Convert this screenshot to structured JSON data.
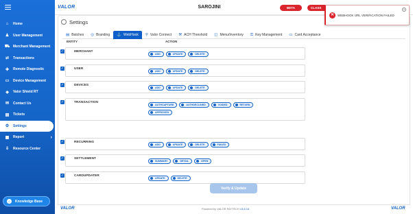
{
  "sidebar": {
    "items": [
      {
        "label": "Home",
        "icon": "home-icon"
      },
      {
        "label": "User Management",
        "icon": "user-icon"
      },
      {
        "label": "Merchant Management",
        "icon": "merchant-icon"
      },
      {
        "label": "Transactions",
        "icon": "transactions-icon"
      },
      {
        "label": "Remote Diagnostic",
        "icon": "diagnostic-icon"
      },
      {
        "label": "Device Management",
        "icon": "device-icon"
      },
      {
        "label": "Valor Shield RT",
        "icon": "shield-icon"
      },
      {
        "label": "Contact Us",
        "icon": "contact-icon"
      },
      {
        "label": "Tickets",
        "icon": "ticket-icon"
      },
      {
        "label": "Settings",
        "icon": "gear-icon"
      },
      {
        "label": "Report",
        "icon": "report-icon"
      },
      {
        "label": "Resource Center",
        "icon": "download-icon"
      }
    ],
    "active_index": 9,
    "knowledge_base": "Knowledge Base"
  },
  "header": {
    "logo": "VALOR",
    "store_name": "SAROJINI",
    "beta_label": "BETA",
    "classic_label": "CLASS"
  },
  "page": {
    "title": "Settings",
    "tabs": [
      {
        "label": "Batches",
        "icon": "batches-icon"
      },
      {
        "label": "Branding",
        "icon": "branding-icon"
      },
      {
        "label": "WebHook",
        "icon": "webhook-icon"
      },
      {
        "label": "Valor Connect",
        "icon": "link-icon"
      },
      {
        "label": "ACH Threshold",
        "icon": "threshold-icon"
      },
      {
        "label": "Menu/Inventory",
        "icon": "inventory-icon"
      },
      {
        "label": "Key Management",
        "icon": "key-icon"
      },
      {
        "label": "Card Acceptance",
        "icon": "card-icon"
      }
    ],
    "active_tab": 2,
    "columns": {
      "entity": "ENTITY",
      "action": "ACTION"
    },
    "rows": [
      {
        "entity": "MERCHANT",
        "checked": true,
        "actions": [
          "ADD",
          "UPDATE",
          "DELETE"
        ]
      },
      {
        "entity": "USER",
        "checked": true,
        "actions": [
          "ADD",
          "UPDATE",
          "DELETE"
        ]
      },
      {
        "entity": "DEVICES",
        "checked": true,
        "actions": [
          "ADD",
          "UPDATE",
          "DELETE"
        ]
      },
      {
        "entity": "TRANSACTION",
        "checked": true,
        "actions": [
          "AUTHCAPTURE",
          "AUTHDECLINED",
          "VOIDED",
          "RETURN",
          "APPROVED"
        ]
      },
      {
        "entity": "RECURRING",
        "checked": true,
        "actions": [
          "ADD",
          "UPDATE",
          "DELETE",
          "FAILED"
        ]
      },
      {
        "entity": "SETTLEMENT",
        "checked": true,
        "actions": [
          "SUMMARY",
          "DETAIL",
          "OPEN"
        ]
      },
      {
        "entity": "CARDUPDATER",
        "checked": true,
        "actions": [
          "UPDATE",
          "DELETE"
        ]
      }
    ],
    "verify_button": "Verify & Update"
  },
  "footer": {
    "logo_left": "VALOR",
    "powered_prefix": "Powered by VALOR PAYTECH",
    "version": "v3.8.16",
    "logo_right": "VALOR"
  },
  "toast": {
    "message": "WEBHOOK URL VERIFICATION FAILED"
  },
  "colors": {
    "primary": "#1565c8",
    "error": "#d9252b",
    "verify_disabled": "#a8c6ec"
  }
}
